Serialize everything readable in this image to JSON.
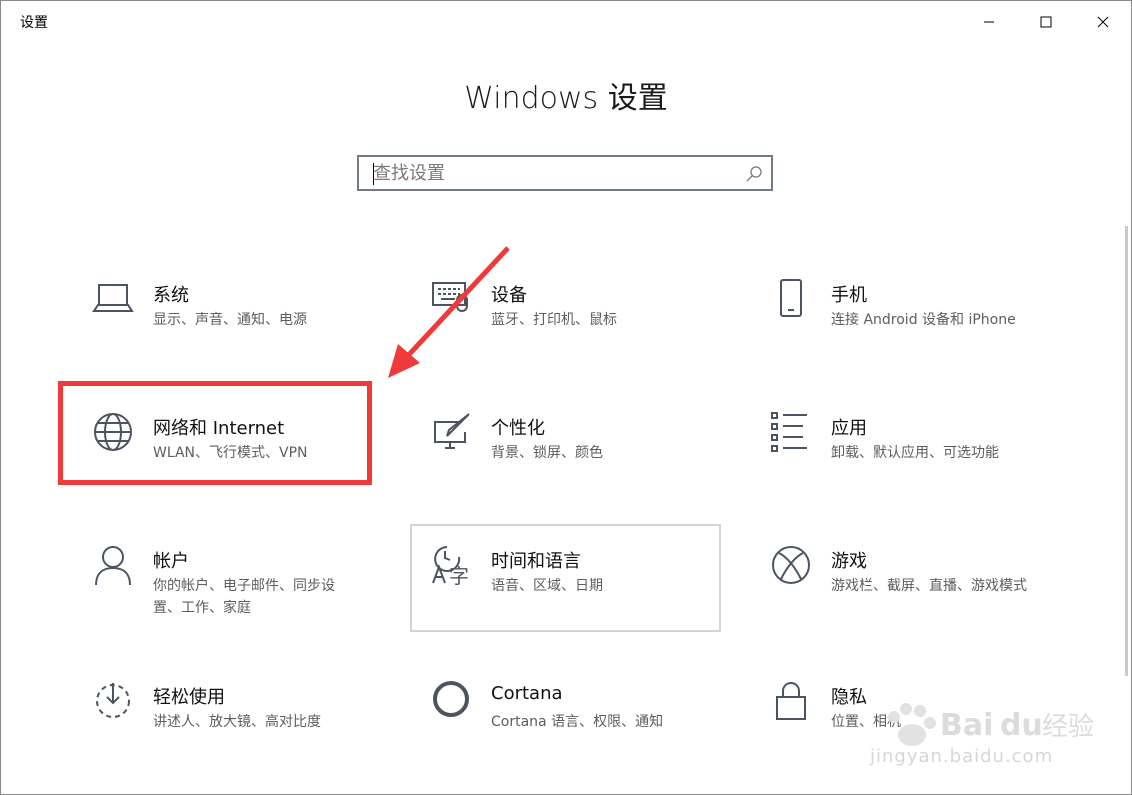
{
  "window": {
    "title": "设置",
    "controls": [
      "minimize",
      "maximize",
      "close"
    ]
  },
  "main": {
    "heading": "Windows 设置",
    "search": {
      "placeholder": "查找设置",
      "value": ""
    },
    "tiles": [
      {
        "id": "system",
        "title": "系统",
        "desc": "显示、声音、通知、电源",
        "icon": "laptop-icon"
      },
      {
        "id": "devices",
        "title": "设备",
        "desc": "蓝牙、打印机、鼠标",
        "icon": "keyboard-icon"
      },
      {
        "id": "phone",
        "title": "手机",
        "desc": "连接 Android 设备和 iPhone",
        "icon": "phone-icon"
      },
      {
        "id": "network",
        "title": "网络和 Internet",
        "desc": "WLAN、飞行模式、VPN",
        "icon": "globe-icon"
      },
      {
        "id": "personalization",
        "title": "个性化",
        "desc": "背景、锁屏、颜色",
        "icon": "paint-icon"
      },
      {
        "id": "apps",
        "title": "应用",
        "desc": "卸载、默认应用、可选功能",
        "icon": "list-icon"
      },
      {
        "id": "accounts",
        "title": "帐户",
        "desc": "你的帐户、电子邮件、同步设置、工作、家庭",
        "icon": "person-icon"
      },
      {
        "id": "time-language",
        "title": "时间和语言",
        "desc": "语音、区域、日期",
        "icon": "time-language-icon"
      },
      {
        "id": "gaming",
        "title": "游戏",
        "desc": "游戏栏、截屏、直播、游戏模式",
        "icon": "xbox-icon"
      },
      {
        "id": "ease",
        "title": "轻松使用",
        "desc": "讲述人、放大镜、高对比度",
        "icon": "ease-of-access-icon"
      },
      {
        "id": "cortana",
        "title": "Cortana",
        "desc": "Cortana 语言、权限、通知",
        "icon": "cortana-icon"
      },
      {
        "id": "privacy",
        "title": "隐私",
        "desc": "位置、相机",
        "icon": "lock-icon"
      }
    ]
  },
  "watermark": {
    "text": "jingyan.baidu.com"
  },
  "colors": {
    "highlight": "#f03a3a",
    "icon": "#4a5561"
  }
}
